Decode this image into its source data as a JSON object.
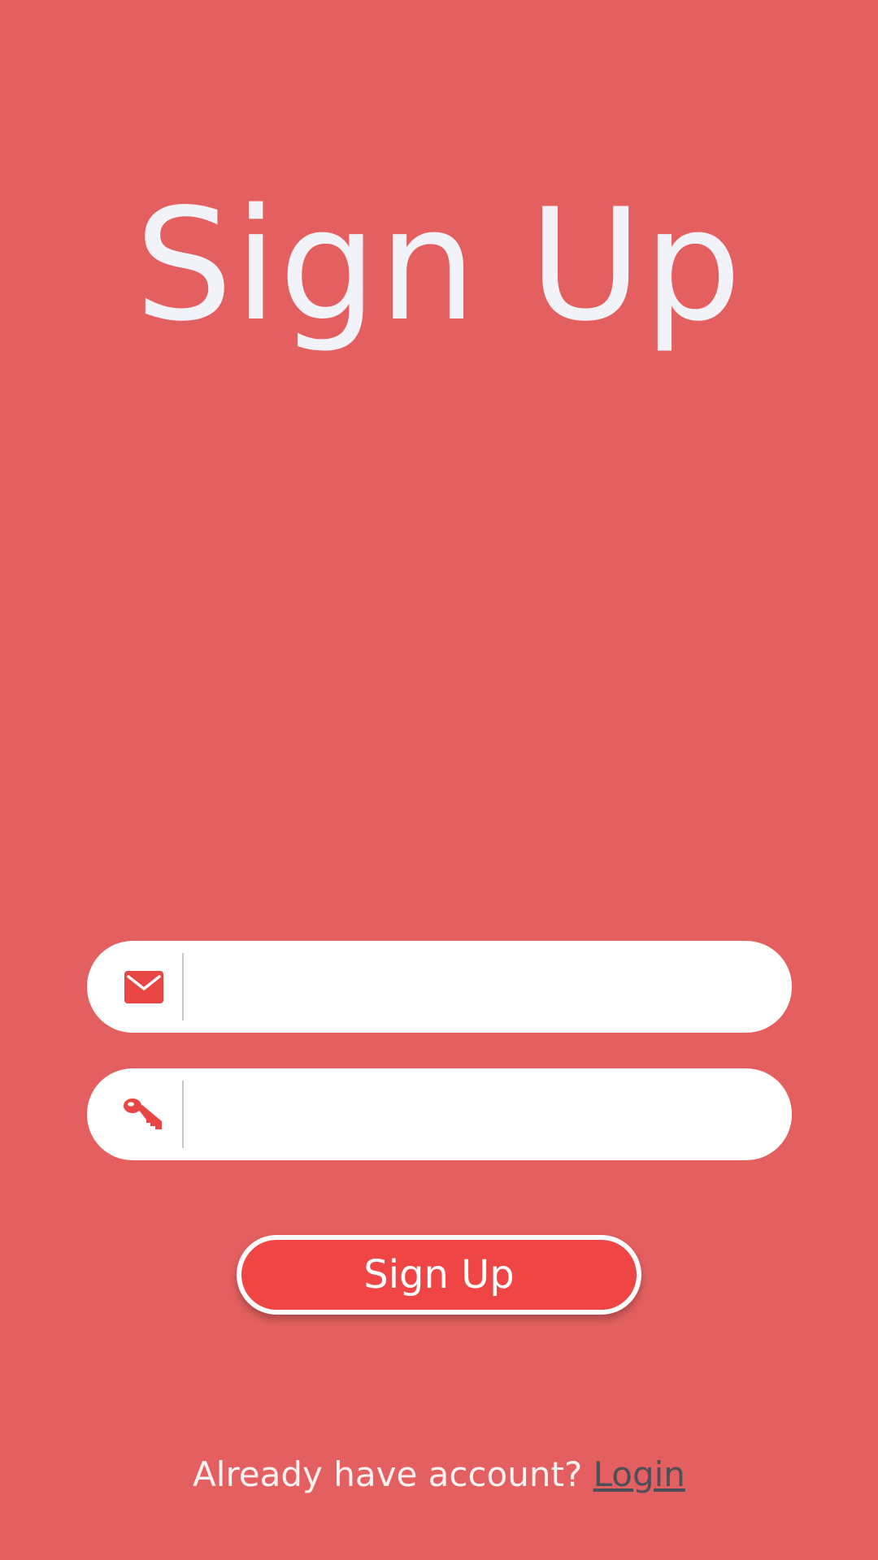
{
  "screen": {
    "title": "Sign Up",
    "background_color": "#e46060"
  },
  "form": {
    "email": {
      "icon": "envelope-icon",
      "value": "",
      "placeholder": ""
    },
    "password": {
      "icon": "key-icon",
      "value": "",
      "placeholder": ""
    },
    "submit_label": "Sign Up",
    "submit_color": "#ef4545",
    "icon_color": "#e84545"
  },
  "footer": {
    "prompt": "Already have account?",
    "link_label": "Login"
  }
}
